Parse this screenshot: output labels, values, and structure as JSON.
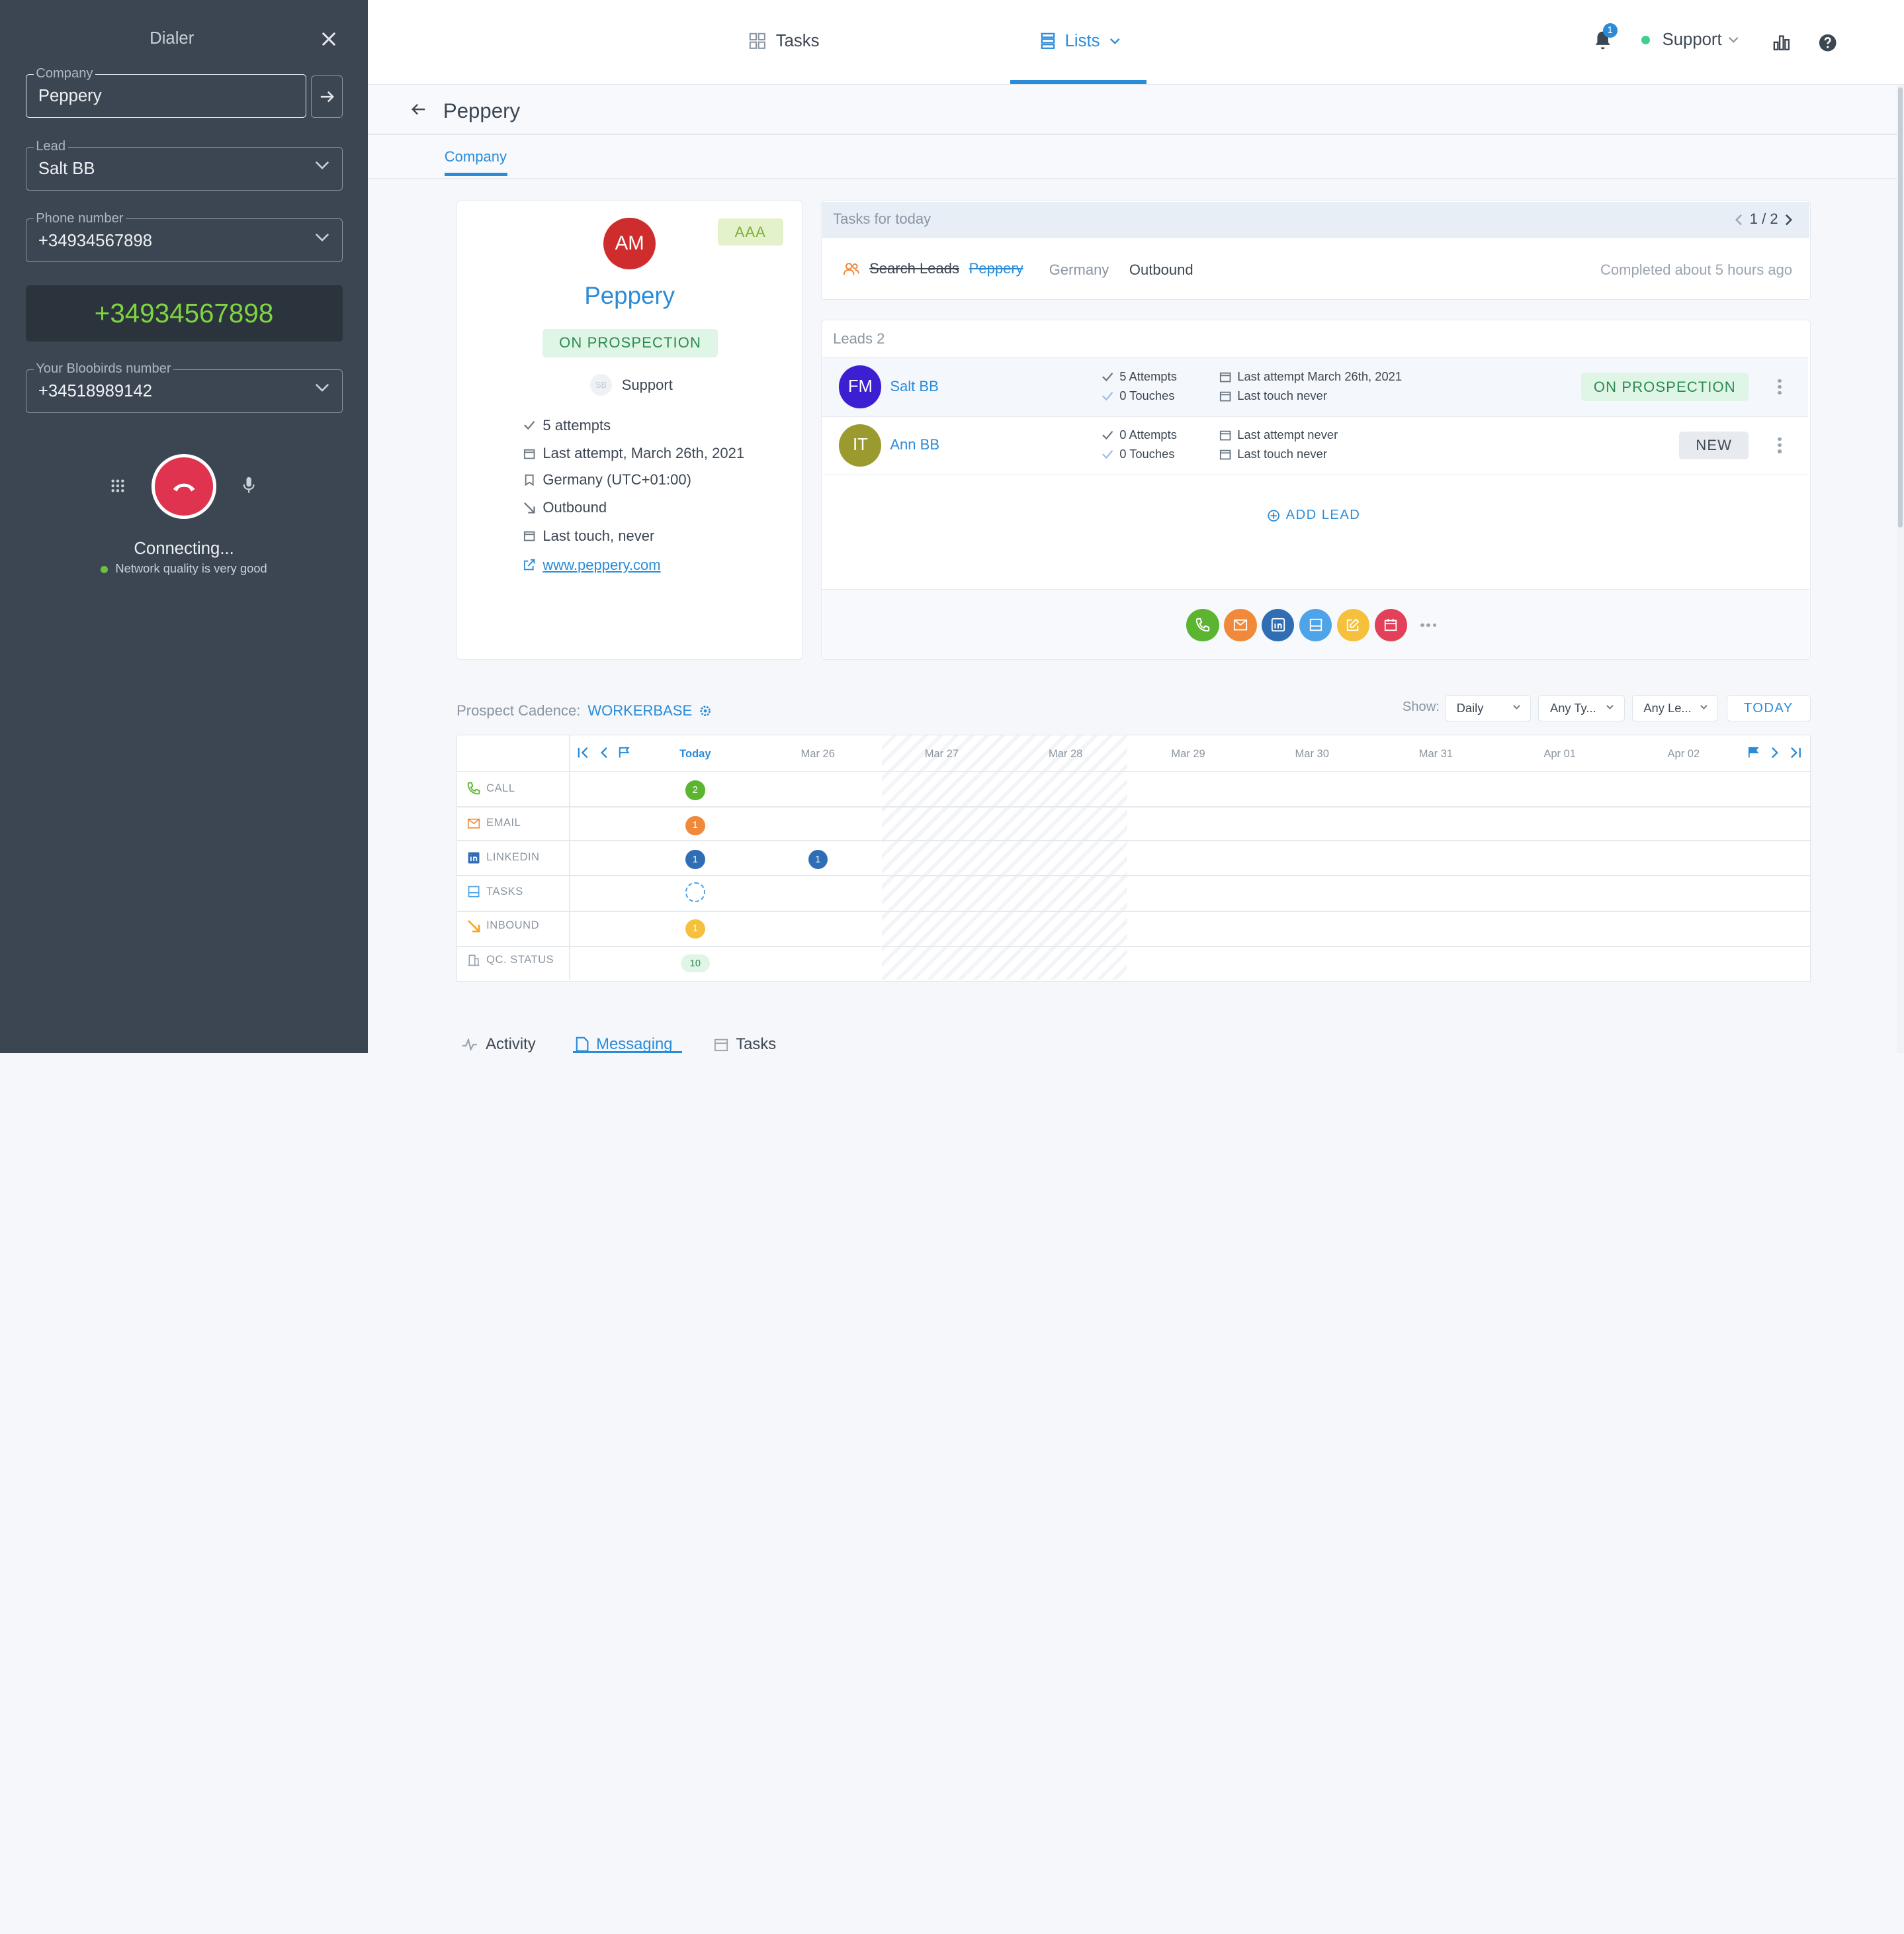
{
  "dialer": {
    "title": "Dialer",
    "company_label": "Company",
    "company_value": "Peppery",
    "lead_label": "Lead",
    "lead_value": "Salt BB",
    "phone_label": "Phone number",
    "phone_value": "+34934567898",
    "display_number": "+34934567898",
    "bloobirds_label": "Your Bloobirds number",
    "bloobirds_value": "+34518989142",
    "status": "Connecting...",
    "network": "Network quality is very good"
  },
  "header": {
    "tasks_label": "Tasks",
    "lists_label": "Lists",
    "notifications_count": "1",
    "user_label": "Support"
  },
  "company_page": {
    "title": "Peppery",
    "tab": "Company"
  },
  "company_card": {
    "avatar": "AM",
    "name": "Peppery",
    "tier": "AAA",
    "status": "ON PROSPECTION",
    "owner_initials": "SB",
    "owner": "Support",
    "attempts": "5 attempts",
    "last_attempt": "Last attempt, March 26th, 2021",
    "country": "Germany (UTC+01:00)",
    "direction": "Outbound",
    "last_touch": "Last touch, never",
    "website": "www.peppery.com"
  },
  "tasks_today": {
    "header": "Tasks for today",
    "pager": "1 / 2",
    "task_name": "Search Leads",
    "task_company": "Peppery",
    "task_country": "Germany",
    "task_type": "Outbound",
    "task_status": "Completed about 5 hours ago"
  },
  "leads": {
    "header": "Leads 2",
    "items": [
      {
        "initials": "FM",
        "name": "Salt BB",
        "attempts": "5 Attempts",
        "touches": "0 Touches",
        "last_attempt": "Last attempt March 26th, 2021",
        "last_touch": "Last touch never",
        "status": "ON PROSPECTION",
        "avatar_color": "#3b1fd1"
      },
      {
        "initials": "IT",
        "name": "Ann BB",
        "attempts": "0 Attempts",
        "touches": "0 Touches",
        "last_attempt": "Last attempt never",
        "last_touch": "Last touch never",
        "status": "NEW",
        "avatar_color": "#9a9a2e"
      }
    ],
    "add_lead": "ADD LEAD"
  },
  "cadence": {
    "label": "Prospect Cadence:",
    "name": "WORKERBASE",
    "show_label": "Show:",
    "filter_period": "Daily",
    "filter_type": "Any Ty...",
    "filter_lead": "Any Le...",
    "today_button": "TODAY",
    "columns": [
      "Today",
      "Mar 26",
      "Mar 27",
      "Mar 28",
      "Mar 29",
      "Mar 30",
      "Mar 31",
      "Apr 01",
      "Apr 02"
    ],
    "rows": [
      "CALL",
      "EMAIL",
      "LINKEDIN",
      "TASKS",
      "INBOUND",
      "QC. STATUS"
    ],
    "counts": {
      "call_today": "2",
      "email_today": "1",
      "linkedin_today": "1",
      "linkedin_mar26": "1",
      "inbound_today": "1",
      "status_today": "10"
    }
  },
  "bottom_tabs": [
    "Activity",
    "Messaging",
    "Tasks"
  ],
  "colors": {
    "accent": "#2a8cd9",
    "prospection": "#dff5e6",
    "dialer_bg": "#3c4652"
  }
}
